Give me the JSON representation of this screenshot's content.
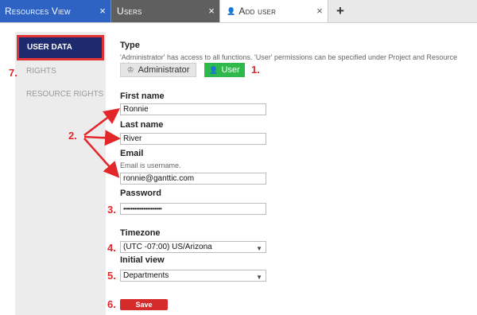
{
  "tabs": [
    {
      "label": "Resources View"
    },
    {
      "label": "Users"
    },
    {
      "label": "Add user"
    }
  ],
  "sidebar": {
    "items": [
      {
        "label": "User data"
      },
      {
        "label": "Rights"
      },
      {
        "label": "Resource rights"
      }
    ]
  },
  "form": {
    "type": {
      "label": "Type",
      "help": "'Administrator' has access to all functions. 'User' permissions can be specified under Project and Resource rights.",
      "admin_label": "Administrator",
      "user_label": "User",
      "selected": "User"
    },
    "first_name": {
      "label": "First name",
      "value": "Ronnie"
    },
    "last_name": {
      "label": "Last name",
      "value": "River"
    },
    "email": {
      "label": "Email",
      "help": "Email is username.",
      "value": "ronnie@ganttic.com"
    },
    "password": {
      "label": "Password",
      "value": "•••••••••••••••••••••"
    },
    "timezone": {
      "label": "Timezone",
      "value": "(UTC -07:00) US/Arizona"
    },
    "initial_view": {
      "label": "Initial view",
      "value": "Departments"
    },
    "save_label": "Save"
  },
  "annotations": {
    "m1": "1.",
    "m2": "2.",
    "m3": "3.",
    "m4": "4.",
    "m5": "5.",
    "m6": "6.",
    "m7": "7."
  },
  "colors": {
    "accent_blue": "#2e63c4",
    "active_sidebar": "#1d2a6e",
    "user_green": "#2fb84b",
    "save_red": "#d62b2b",
    "annotation_red": "#e3262a"
  }
}
